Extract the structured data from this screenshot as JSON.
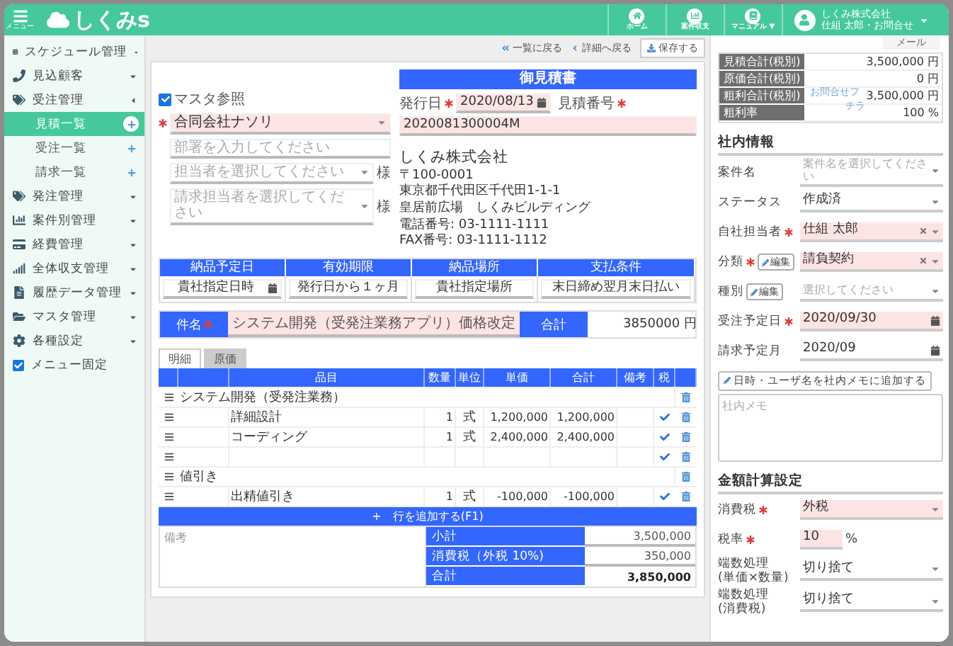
{
  "header": {
    "menu_label": "メニュー",
    "logo": "しくみs",
    "nav": [
      {
        "label": "ホーム"
      },
      {
        "label": "案件収支"
      },
      {
        "label": "マニュアル ▼"
      }
    ],
    "company": "しくみ株式会社",
    "user_line": "仕組 太郎・お問合せ",
    "popup": "メール"
  },
  "sidebar": {
    "items": [
      {
        "label": "スケジュール管理",
        "expanded": false
      },
      {
        "label": "見込顧客",
        "expanded": false
      },
      {
        "label": "受注管理",
        "expanded": true,
        "children": [
          {
            "label": "見積一覧",
            "selected": true
          },
          {
            "label": "受注一覧",
            "selected": false
          },
          {
            "label": "請求一覧",
            "selected": false
          }
        ]
      },
      {
        "label": "発注管理",
        "expanded": false
      },
      {
        "label": "案件別管理",
        "expanded": false
      },
      {
        "label": "経費管理",
        "expanded": false
      },
      {
        "label": "全体収支管理",
        "expanded": false
      },
      {
        "label": "履歴データ管理",
        "expanded": false
      },
      {
        "label": "マスタ管理",
        "expanded": false
      },
      {
        "label": "各種設定",
        "expanded": false
      }
    ],
    "menu_pin": {
      "label": "メニュー固定",
      "checked": true
    }
  },
  "toolbar": [
    {
      "label": "一覧に戻る",
      "kind": "link"
    },
    {
      "label": "詳細へ戻る",
      "kind": "link"
    },
    {
      "label": "保存する",
      "kind": "button"
    }
  ],
  "document": {
    "title": "御見積書",
    "master_ref": {
      "label": "マスタ参照",
      "checked": true
    },
    "customer": {
      "value": "合同会社ナソリ",
      "required": true
    },
    "department": {
      "placeholder": "部署を入力してください"
    },
    "contact": {
      "placeholder": "担当者を選択してください",
      "suffix": "様"
    },
    "billing_contact": {
      "placeholder": "請求担当者を選択してください",
      "suffix": "様"
    },
    "issue_date": {
      "label": "発行日",
      "value": "2020/08/13",
      "required": true
    },
    "number": {
      "label": "見積番号",
      "value": "2020081300004M",
      "required": true
    },
    "issuer": [
      "しくみ株式会社",
      "〒100-0001",
      "東京都千代田区千代田1-1-1",
      "皇居前広場　しくみビルディング",
      "電話番号:  03-1111-1111",
      "FAX番号:  03-1111-1112"
    ],
    "conditions": [
      {
        "label": "納品予定日",
        "value": "貴社指定日時",
        "kind": "date"
      },
      {
        "label": "有効期限",
        "value": "発行日から１ヶ月",
        "kind": "text"
      },
      {
        "label": "納品場所",
        "value": "貴社指定場所",
        "kind": "text"
      },
      {
        "label": "支払条件",
        "value": "末日締め翌月末日払い",
        "kind": "text"
      }
    ],
    "subject": {
      "label": "件名",
      "required": true,
      "value": "システム開発（受発注業務アプリ）価格改定",
      "total_label": "合計",
      "total": "3850000 円"
    }
  },
  "tabs": [
    {
      "label": "明細",
      "selected": true
    },
    {
      "label": "原価",
      "selected": false
    }
  ],
  "table": {
    "columns": [
      "品目",
      "数量",
      "単位",
      "単価",
      "合計",
      "備考",
      "税"
    ],
    "rows": [
      {
        "kind": "group",
        "name": "システム開発（受発注業務）"
      },
      {
        "kind": "item",
        "name": "詳細設計",
        "qty": "1",
        "unit": "式",
        "price": "1,200,000",
        "total": "1,200,000",
        "taxed": true
      },
      {
        "kind": "item",
        "name": "コーディング",
        "qty": "1",
        "unit": "式",
        "price": "2,400,000",
        "total": "2,400,000",
        "taxed": true
      },
      {
        "kind": "item",
        "taxed": true
      },
      {
        "kind": "group",
        "name": "値引き"
      },
      {
        "kind": "item",
        "name": "出精値引き",
        "qty": "1",
        "unit": "式",
        "price": "-100,000",
        "total": "-100,000",
        "taxed": true
      }
    ],
    "add_row": "+　行を追加する(F1)"
  },
  "notes": {
    "placeholder": "備考"
  },
  "totals": [
    {
      "label": "小計",
      "value": "3,500,000",
      "kind": "field"
    },
    {
      "label": "消費税（外税 10%)",
      "value": "350,000",
      "kind": "field"
    },
    {
      "label": "合計",
      "value": "3,850,000",
      "kind": "grand"
    }
  ],
  "panel": {
    "summary": [
      {
        "label": "見積合計(税別)",
        "value": "3,500,000 円"
      },
      {
        "label": "原価合計(税別)",
        "value": "0 円"
      },
      {
        "label": "粗利合計(税別)",
        "value": "3,500,000 円"
      },
      {
        "label": "粗利率",
        "value": "100 %"
      }
    ],
    "overlay_texts": [
      "お問合せフ",
      "チラ"
    ],
    "internal": {
      "heading": "社内情報",
      "fields": [
        {
          "label": "案件名",
          "placeholder": "案件名を選択してください",
          "kind": "select"
        },
        {
          "label": "ステータス",
          "value": "作成済",
          "kind": "select"
        },
        {
          "label": "自社担当者",
          "value": "仕組 太郎",
          "required": true,
          "clearable": true,
          "kind": "select"
        },
        {
          "label": "分類",
          "value": "請負契約",
          "required": true,
          "clearable": true,
          "edit": "編集",
          "kind": "select"
        },
        {
          "label": "種別",
          "placeholder": "選択してください",
          "edit": "編集",
          "kind": "select"
        },
        {
          "label": "受注予定日",
          "value": "2020/09/30",
          "required": true,
          "kind": "date"
        },
        {
          "label": "請求予定月",
          "value": "2020/09",
          "kind": "date"
        }
      ],
      "memo_button": "日時・ユーザ名を社内メモに追加する",
      "memo": {
        "placeholder": "社内メモ"
      }
    },
    "calc": {
      "heading": "金額計算設定",
      "fields": [
        {
          "label": "消費税",
          "value": "外税",
          "required": true,
          "kind": "select"
        },
        {
          "label": "税率",
          "value": "10",
          "unit": "%",
          "required": true,
          "kind": "rate"
        },
        {
          "label": "端数処理\n(単価×数量)",
          "value": "切り捨て",
          "kind": "select"
        },
        {
          "label": "端数処理\n(消費税)",
          "value": "切り捨て",
          "kind": "select"
        }
      ]
    }
  }
}
